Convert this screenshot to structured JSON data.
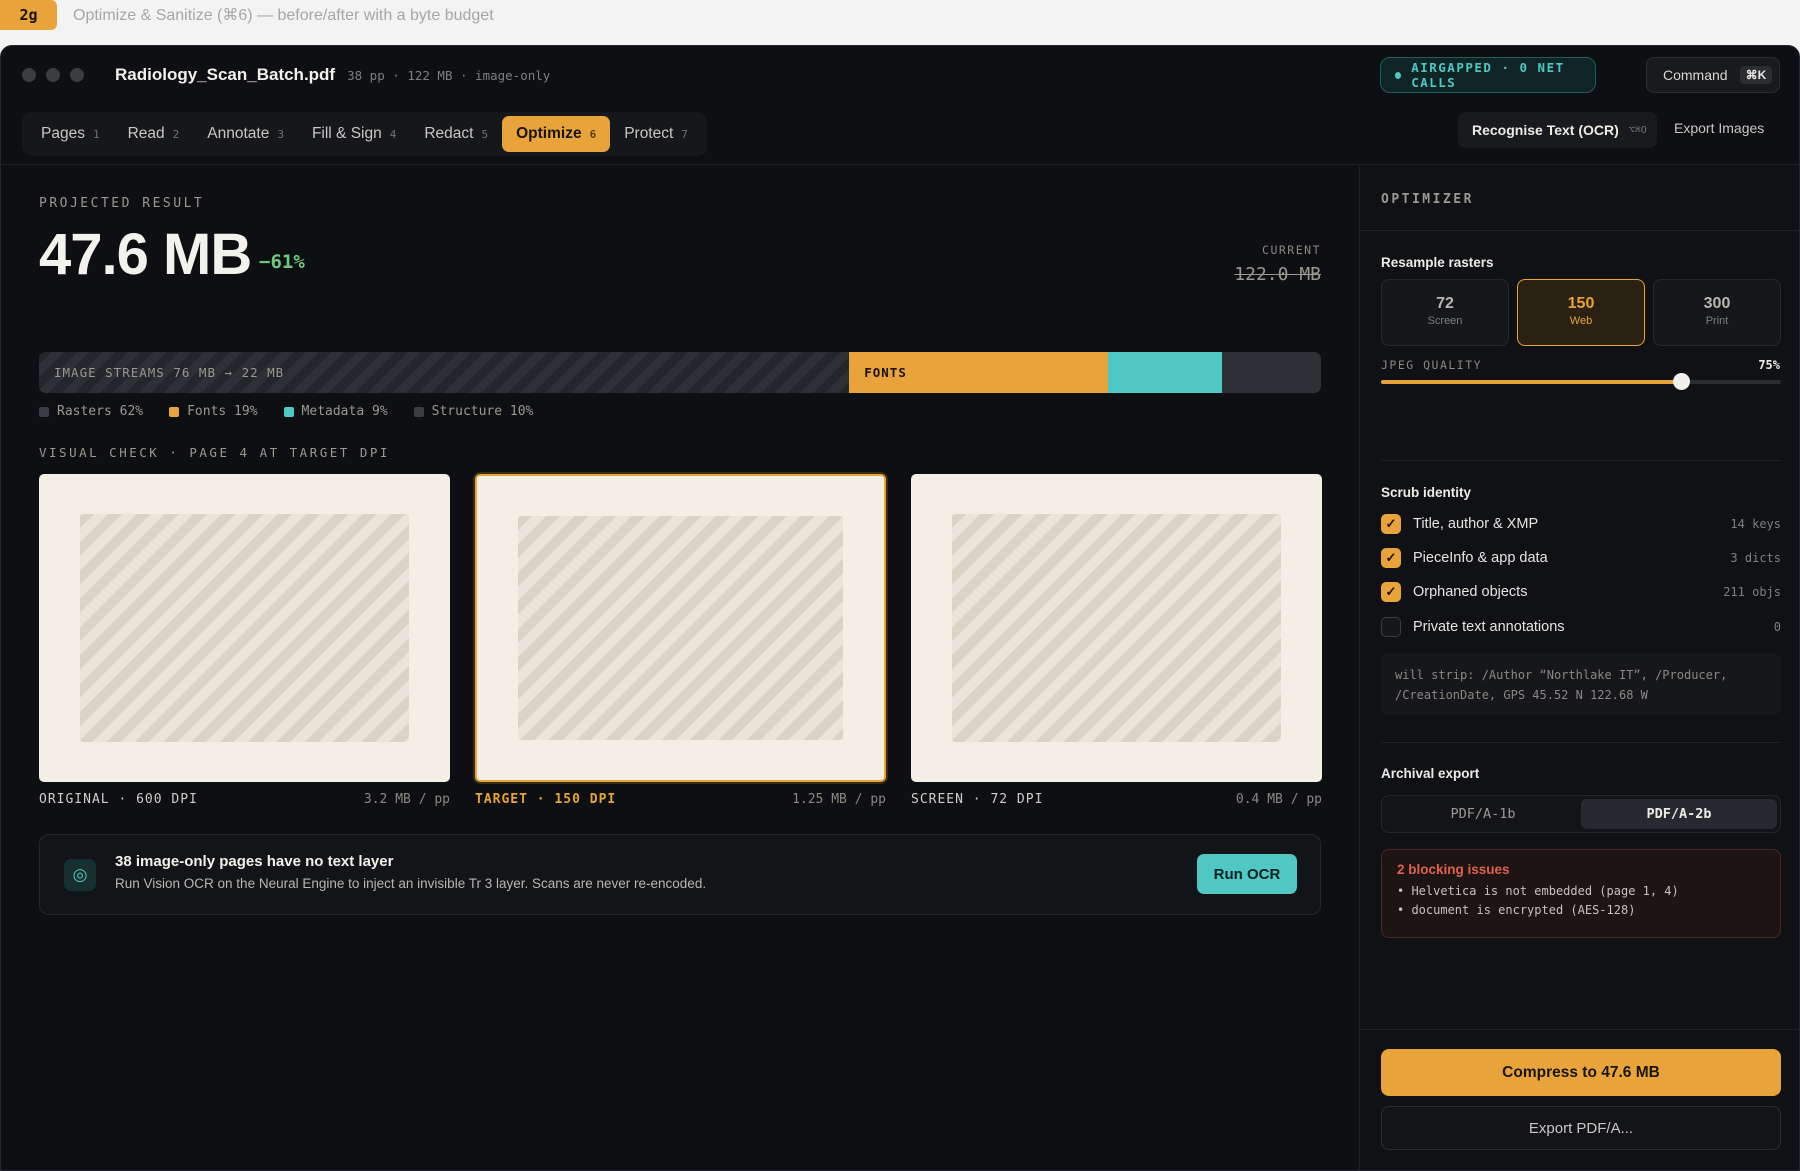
{
  "caption": {
    "badge": "2g",
    "text": "Optimize & Sanitize (⌘6) — before/after with a byte budget"
  },
  "window": {
    "file_name": "Radiology_Scan_Batch.pdf",
    "file_meta": "38 pp · 122 MB · image-only",
    "net_status": "AIRGAPPED · 0 NET CALLS",
    "command_label": "Command",
    "command_key": "⌘K"
  },
  "tabs": [
    {
      "label": "Pages",
      "num": "1"
    },
    {
      "label": "Read",
      "num": "2"
    },
    {
      "label": "Annotate",
      "num": "3"
    },
    {
      "label": "Fill & Sign",
      "num": "4"
    },
    {
      "label": "Redact",
      "num": "5"
    },
    {
      "label": "Optimize",
      "num": "6",
      "active": true
    },
    {
      "label": "Protect",
      "num": "7"
    }
  ],
  "toolbar": {
    "ocr_label": "Recognise Text (OCR)",
    "ocr_key": "⌥⌘O",
    "export_images": "Export Images"
  },
  "projected": {
    "label": "PROJECTED RESULT",
    "size": "47.6 MB",
    "delta": "−61%",
    "current_label": "CURRENT",
    "current_value": "122.0 MB"
  },
  "breakdown": {
    "segments": [
      {
        "key": "rasters",
        "label": "IMAGE STREAMS 76 MB → 22 MB",
        "percent": 63.2
      },
      {
        "key": "fonts",
        "label": "FONTS",
        "percent": 20.2
      },
      {
        "key": "metadata",
        "label": "",
        "percent": 8.9
      },
      {
        "key": "structure",
        "label": "",
        "percent": 7.7
      }
    ],
    "legend": [
      {
        "label": "Rasters 62%",
        "color": "#3a3c41"
      },
      {
        "label": "Fonts 19%",
        "color": "#e8a33a"
      },
      {
        "label": "Metadata 9%",
        "color": "#4fc7c2"
      },
      {
        "label": "Structure 10%",
        "color": "#3a3c41"
      }
    ]
  },
  "visual_check": {
    "label": "VISUAL CHECK · PAGE 4 AT TARGET DPI",
    "previews": [
      {
        "label": "ORIGINAL · 600 DPI",
        "size": "3.2 MB / pp"
      },
      {
        "label": "TARGET · 150 DPI",
        "size": "1.25 MB / pp"
      },
      {
        "label": "SCREEN · 72 DPI",
        "size": "0.4 MB / pp"
      }
    ]
  },
  "ocr_notice": {
    "title": "38 image-only pages have no text layer",
    "subtitle": "Run Vision OCR on the Neural Engine to inject an invisible Tr 3 layer. Scans are never re-encoded.",
    "button": "Run OCR"
  },
  "optimizer": {
    "heading": "OPTIMIZER",
    "resample_label": "Resample rasters",
    "dpi_options": [
      {
        "value": "72",
        "label": "Screen"
      },
      {
        "value": "150",
        "label": "Web",
        "selected": true
      },
      {
        "value": "300",
        "label": "Print"
      }
    ],
    "jpeg_label": "JPEG QUALITY",
    "jpeg_value": "75%",
    "jpeg_fraction": 0.75,
    "scrub_label": "Scrub identity",
    "scrub_items": [
      {
        "label": "Title, author & XMP",
        "meta": "14 keys",
        "checked": true
      },
      {
        "label": "PieceInfo & app data",
        "meta": "3 dicts",
        "checked": true
      },
      {
        "label": "Orphaned objects",
        "meta": "211 objs",
        "checked": true
      },
      {
        "label": "Private text annotations",
        "meta": "0",
        "checked": false
      }
    ],
    "strip_line1": "will strip: /Author “Northlake IT”, /Producer,",
    "strip_line2": "/CreationDate, GPS 45.52 N 122.68 W",
    "archival_label": "Archival export",
    "archival_options": [
      {
        "label": "PDF/A-1b"
      },
      {
        "label": "PDF/A-2b",
        "selected": true
      }
    ],
    "issues_title": "2 blocking issues",
    "issues": [
      "• Helvetica is not embedded (page 1, 4)",
      "• document is encrypted (AES-128)"
    ],
    "compress_button": "Compress to 47.6 MB",
    "export_button": "Export PDF/A..."
  }
}
